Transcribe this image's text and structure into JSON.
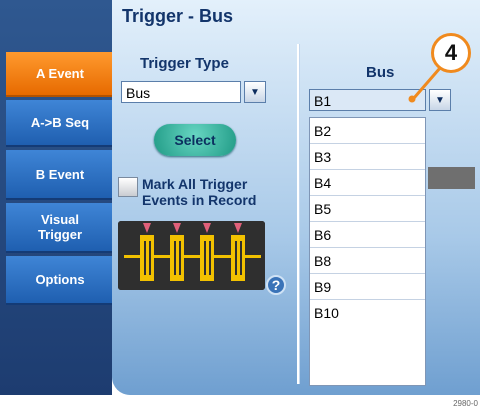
{
  "panel": {
    "title": "Trigger - Bus"
  },
  "nav": [
    {
      "label": "A Event",
      "active": true
    },
    {
      "label": "A->B Seq",
      "active": false
    },
    {
      "label": "B Event",
      "active": false
    },
    {
      "label": "Visual\nTrigger",
      "active": false
    },
    {
      "label": "Options",
      "active": false
    }
  ],
  "trigger_type": {
    "label": "Trigger Type",
    "value": "Bus",
    "select_button": "Select",
    "mark_all_label": "Mark All Trigger Events in Record"
  },
  "bus": {
    "label": "Bus",
    "selected": "B1",
    "options": [
      "B1",
      "B2",
      "B3",
      "B4",
      "B5",
      "B6",
      "B8",
      "B9",
      "B10"
    ]
  },
  "callout": {
    "number": "4"
  },
  "figure_code": "2980-0",
  "colors": {
    "active_tab": "#f08a1e",
    "tab": "#2f78cc",
    "panel": "#a8c9e8"
  }
}
